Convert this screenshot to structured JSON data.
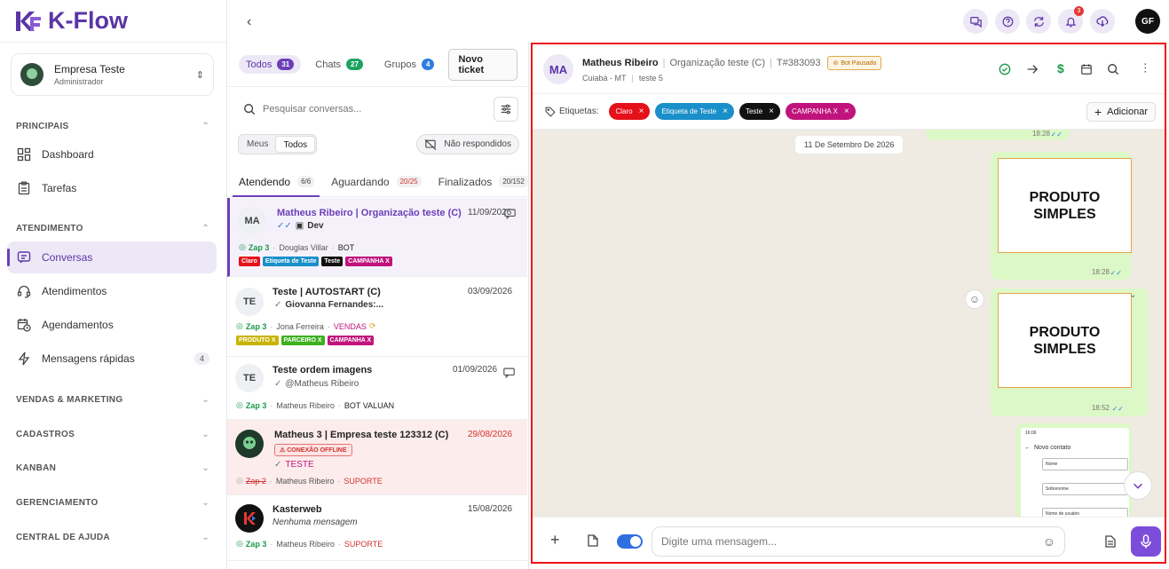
{
  "brand": {
    "name": "K-Flow",
    "logo_color": "#5b35a6"
  },
  "company": {
    "name": "Empresa Teste",
    "role": "Administrador"
  },
  "sidebar": {
    "sections": [
      {
        "label": "PRINCIPAIS",
        "expanded": true
      },
      {
        "label": "ATENDIMENTO",
        "expanded": true
      },
      {
        "label": "VENDAS & MARKETING",
        "expanded": false
      },
      {
        "label": "CADASTROS",
        "expanded": false
      },
      {
        "label": "KANBAN",
        "expanded": false
      },
      {
        "label": "GERENCIAMENTO",
        "expanded": false
      },
      {
        "label": "CENTRAL DE AJUDA",
        "expanded": false
      }
    ],
    "items": [
      {
        "label": "Dashboard",
        "icon": "dashboard-icon"
      },
      {
        "label": "Tarefas",
        "icon": "clipboard-icon"
      },
      {
        "label": "Conversas",
        "icon": "chat-icon",
        "active": true
      },
      {
        "label": "Atendimentos",
        "icon": "headset-icon"
      },
      {
        "label": "Agendamentos",
        "icon": "calendar-clock-icon"
      },
      {
        "label": "Mensagens rápidas",
        "icon": "lightning-icon",
        "count": "4"
      }
    ]
  },
  "topbar": {
    "notification_count": "3",
    "user_initials": "GF"
  },
  "list": {
    "filter_tabs": [
      {
        "label": "Todos",
        "count": "31",
        "color": "#6b3fb8"
      },
      {
        "label": "Chats",
        "count": "27",
        "color": "#1ea362"
      },
      {
        "label": "Grupos",
        "count": "4",
        "color": "#2f7de1"
      }
    ],
    "new_ticket": "Novo ticket",
    "search_placeholder": "Pesquisar conversas...",
    "segment": [
      "Meus",
      "Todos"
    ],
    "not_answered": "Não respondidos",
    "status_tabs": [
      {
        "label": "Atendendo",
        "count": "6/6"
      },
      {
        "label": "Aguardando",
        "count": "20/25"
      },
      {
        "label": "Finalizados",
        "count": "20/152"
      }
    ],
    "tickets": [
      {
        "avatar": "MA",
        "name": "Matheus Ribeiro | Organização teste (C)",
        "date": "11/09/2026",
        "last": "Dev",
        "zap": "Zap 3",
        "agent": "Douglas Villar",
        "queue": "BOT",
        "tags": [
          {
            "t": "Claro",
            "c": "#e5101a"
          },
          {
            "t": "Etiqueta de Teste",
            "c": "#1a8fc9"
          },
          {
            "t": "Teste",
            "c": "#111111"
          },
          {
            "t": "CAMPANHA X",
            "c": "#c0147c"
          }
        ]
      },
      {
        "avatar": "TE",
        "name": "Teste | AUTOSTART (C)",
        "date": "03/09/2026",
        "last": "Giovanna Fernandes:...",
        "zap": "Zap 3",
        "agent": "Jona Ferreira",
        "queue": "VENDAS",
        "tags": [
          {
            "t": "PRODUTO X",
            "c": "#c8b400"
          },
          {
            "t": "PARCEIRO X",
            "c": "#3cb01d"
          },
          {
            "t": "CAMPANHA X",
            "c": "#c0147c"
          }
        ]
      },
      {
        "avatar": "TE",
        "name": "Teste ordem imagens",
        "date": "01/09/2026",
        "last": "@Matheus Ribeiro",
        "zap": "Zap 3",
        "agent": "Matheus Ribeiro",
        "queue": "BOT VALUAN",
        "tags": []
      },
      {
        "avatar": "",
        "name": "Matheus 3 | Empresa teste 123312 (C)",
        "date": "29/08/2026",
        "offline": "CONEXÃO OFFLINE",
        "last": "TESTE",
        "zap": "Zap 2",
        "agent": "Matheus Ribeiro",
        "queue": "SUPORTE",
        "tags": []
      },
      {
        "avatar": "",
        "name": "Kasterweb",
        "date": "15/08/2026",
        "last": "Nenhuma mensagem",
        "zap": "Zap 3",
        "agent": "Matheus Ribeiro",
        "queue": "SUPORTE",
        "tags": []
      }
    ]
  },
  "chat": {
    "avatar": "MA",
    "name": "Matheus Ribeiro",
    "org": "Organização teste (C)",
    "ticket": "T#383093",
    "bot_status": "Bot Pausado",
    "city": "Cuiabá - MT",
    "queue": "teste 5",
    "labels_title": "Etiquetas:",
    "labels": [
      {
        "t": "Claro",
        "c": "#e5101a"
      },
      {
        "t": "Etiqueta de Teste",
        "c": "#1a8fc9"
      },
      {
        "t": "Teste",
        "c": "#111111"
      },
      {
        "t": "CAMPANHA X",
        "c": "#c0147c"
      }
    ],
    "add_label": "Adicionar",
    "date_chip": "11 De Setembro De 2026",
    "messages": [
      {
        "time": "18:28"
      },
      {
        "text1": "PRODUTO",
        "text2": "SIMPLES",
        "time": "18:28"
      },
      {
        "text1": "PRODUTO",
        "text2": "SIMPLES",
        "time": "18:52"
      }
    ],
    "screenshot_msg": {
      "clock": "16:06",
      "title": "Novo contato",
      "f1": "Nome",
      "f2": "Sobrenome",
      "f3": "Nome de usuário"
    },
    "composer_placeholder": "Digite uma mensagem..."
  }
}
